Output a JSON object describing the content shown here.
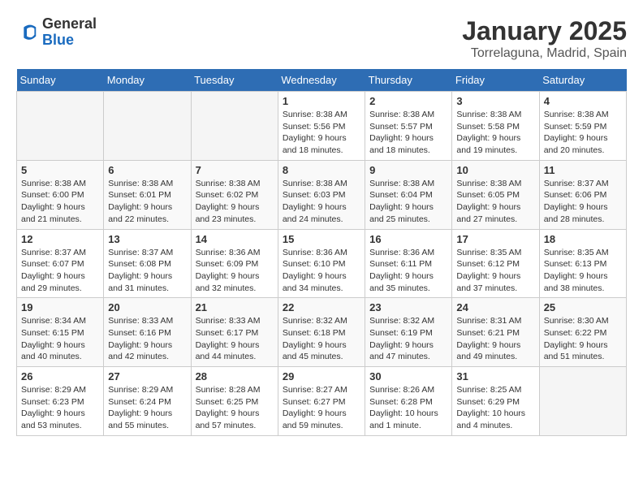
{
  "app": {
    "logo_general": "General",
    "logo_blue": "Blue"
  },
  "calendar": {
    "title": "January 2025",
    "subtitle": "Torrelaguna, Madrid, Spain",
    "days_of_week": [
      "Sunday",
      "Monday",
      "Tuesday",
      "Wednesday",
      "Thursday",
      "Friday",
      "Saturday"
    ],
    "weeks": [
      [
        {
          "day": "",
          "info": ""
        },
        {
          "day": "",
          "info": ""
        },
        {
          "day": "",
          "info": ""
        },
        {
          "day": "1",
          "info": "Sunrise: 8:38 AM\nSunset: 5:56 PM\nDaylight: 9 hours\nand 18 minutes."
        },
        {
          "day": "2",
          "info": "Sunrise: 8:38 AM\nSunset: 5:57 PM\nDaylight: 9 hours\nand 18 minutes."
        },
        {
          "day": "3",
          "info": "Sunrise: 8:38 AM\nSunset: 5:58 PM\nDaylight: 9 hours\nand 19 minutes."
        },
        {
          "day": "4",
          "info": "Sunrise: 8:38 AM\nSunset: 5:59 PM\nDaylight: 9 hours\nand 20 minutes."
        }
      ],
      [
        {
          "day": "5",
          "info": "Sunrise: 8:38 AM\nSunset: 6:00 PM\nDaylight: 9 hours\nand 21 minutes."
        },
        {
          "day": "6",
          "info": "Sunrise: 8:38 AM\nSunset: 6:01 PM\nDaylight: 9 hours\nand 22 minutes."
        },
        {
          "day": "7",
          "info": "Sunrise: 8:38 AM\nSunset: 6:02 PM\nDaylight: 9 hours\nand 23 minutes."
        },
        {
          "day": "8",
          "info": "Sunrise: 8:38 AM\nSunset: 6:03 PM\nDaylight: 9 hours\nand 24 minutes."
        },
        {
          "day": "9",
          "info": "Sunrise: 8:38 AM\nSunset: 6:04 PM\nDaylight: 9 hours\nand 25 minutes."
        },
        {
          "day": "10",
          "info": "Sunrise: 8:38 AM\nSunset: 6:05 PM\nDaylight: 9 hours\nand 27 minutes."
        },
        {
          "day": "11",
          "info": "Sunrise: 8:37 AM\nSunset: 6:06 PM\nDaylight: 9 hours\nand 28 minutes."
        }
      ],
      [
        {
          "day": "12",
          "info": "Sunrise: 8:37 AM\nSunset: 6:07 PM\nDaylight: 9 hours\nand 29 minutes."
        },
        {
          "day": "13",
          "info": "Sunrise: 8:37 AM\nSunset: 6:08 PM\nDaylight: 9 hours\nand 31 minutes."
        },
        {
          "day": "14",
          "info": "Sunrise: 8:36 AM\nSunset: 6:09 PM\nDaylight: 9 hours\nand 32 minutes."
        },
        {
          "day": "15",
          "info": "Sunrise: 8:36 AM\nSunset: 6:10 PM\nDaylight: 9 hours\nand 34 minutes."
        },
        {
          "day": "16",
          "info": "Sunrise: 8:36 AM\nSunset: 6:11 PM\nDaylight: 9 hours\nand 35 minutes."
        },
        {
          "day": "17",
          "info": "Sunrise: 8:35 AM\nSunset: 6:12 PM\nDaylight: 9 hours\nand 37 minutes."
        },
        {
          "day": "18",
          "info": "Sunrise: 8:35 AM\nSunset: 6:13 PM\nDaylight: 9 hours\nand 38 minutes."
        }
      ],
      [
        {
          "day": "19",
          "info": "Sunrise: 8:34 AM\nSunset: 6:15 PM\nDaylight: 9 hours\nand 40 minutes."
        },
        {
          "day": "20",
          "info": "Sunrise: 8:33 AM\nSunset: 6:16 PM\nDaylight: 9 hours\nand 42 minutes."
        },
        {
          "day": "21",
          "info": "Sunrise: 8:33 AM\nSunset: 6:17 PM\nDaylight: 9 hours\nand 44 minutes."
        },
        {
          "day": "22",
          "info": "Sunrise: 8:32 AM\nSunset: 6:18 PM\nDaylight: 9 hours\nand 45 minutes."
        },
        {
          "day": "23",
          "info": "Sunrise: 8:32 AM\nSunset: 6:19 PM\nDaylight: 9 hours\nand 47 minutes."
        },
        {
          "day": "24",
          "info": "Sunrise: 8:31 AM\nSunset: 6:21 PM\nDaylight: 9 hours\nand 49 minutes."
        },
        {
          "day": "25",
          "info": "Sunrise: 8:30 AM\nSunset: 6:22 PM\nDaylight: 9 hours\nand 51 minutes."
        }
      ],
      [
        {
          "day": "26",
          "info": "Sunrise: 8:29 AM\nSunset: 6:23 PM\nDaylight: 9 hours\nand 53 minutes."
        },
        {
          "day": "27",
          "info": "Sunrise: 8:29 AM\nSunset: 6:24 PM\nDaylight: 9 hours\nand 55 minutes."
        },
        {
          "day": "28",
          "info": "Sunrise: 8:28 AM\nSunset: 6:25 PM\nDaylight: 9 hours\nand 57 minutes."
        },
        {
          "day": "29",
          "info": "Sunrise: 8:27 AM\nSunset: 6:27 PM\nDaylight: 9 hours\nand 59 minutes."
        },
        {
          "day": "30",
          "info": "Sunrise: 8:26 AM\nSunset: 6:28 PM\nDaylight: 10 hours\nand 1 minute."
        },
        {
          "day": "31",
          "info": "Sunrise: 8:25 AM\nSunset: 6:29 PM\nDaylight: 10 hours\nand 4 minutes."
        },
        {
          "day": "",
          "info": ""
        }
      ]
    ]
  }
}
